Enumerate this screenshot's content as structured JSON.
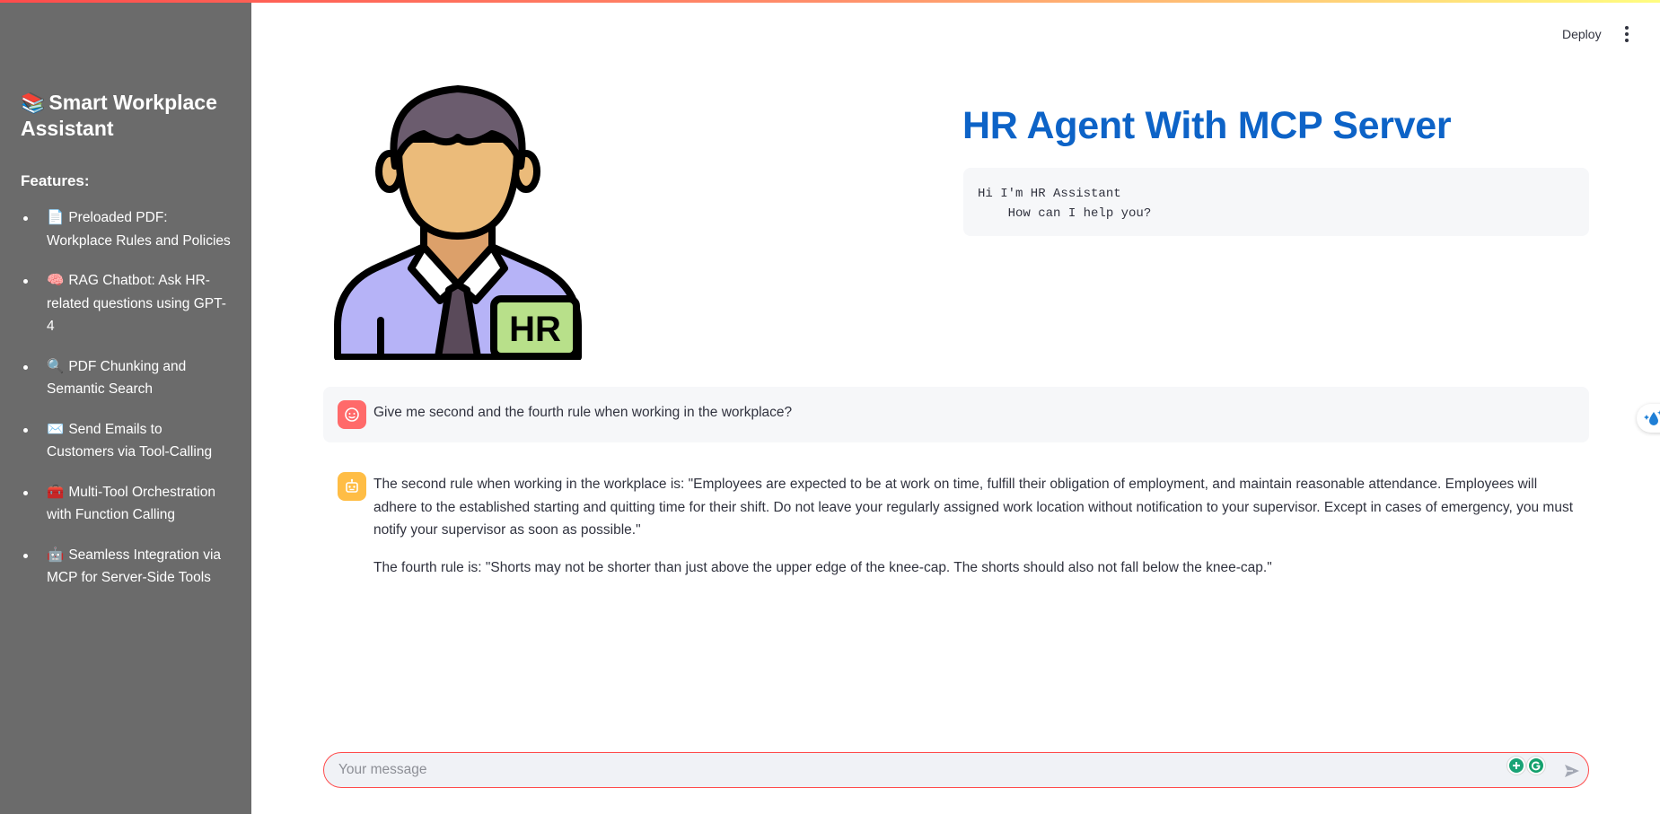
{
  "sidebar": {
    "title_emoji": "📚",
    "title": "Smart Workplace Assistant",
    "features_heading": "Features:",
    "features": [
      {
        "emoji": "📄",
        "label": "Preloaded PDF: Workplace Rules and Policies"
      },
      {
        "emoji": "🧠",
        "label": "RAG Chatbot: Ask HR-related questions using GPT-4"
      },
      {
        "emoji": "🔍",
        "label": "PDF Chunking and Semantic Search"
      },
      {
        "emoji": "✉️",
        "label": "Send Emails to Customers via Tool-Calling"
      },
      {
        "emoji": "🧰",
        "label": "Multi-Tool Orchestration with Function Calling"
      },
      {
        "emoji": "🤖",
        "label": "Seamless Integration via MCP for Server-Side Tools"
      }
    ]
  },
  "header": {
    "deploy_label": "Deploy"
  },
  "avatar": {
    "badge_text": "HR"
  },
  "main": {
    "title": "HR Agent With MCP Server",
    "greeting": "Hi I'm HR Assistant\n    How can I help you?"
  },
  "chat": {
    "user_message": "Give me second and the fourth rule when working in the workplace?",
    "assistant_paragraphs": [
      "The second rule when working in the workplace is: \"Employees are expected to be at work on time, fulfill their obligation of employment, and maintain reasonable attendance. Employees will adhere to the established starting and quitting time for their shift. Do not leave your regularly assigned work location without notification to your supervisor. Except in cases of emergency, you must notify your supervisor as soon as possible.\"",
      "The fourth rule is: \"Shorts may not be shorter than just above the upper edge of the knee-cap. The shorts should also not fall below the knee-cap.\""
    ],
    "input_placeholder": "Your message"
  },
  "colors": {
    "sidebar_bg": "#6b6b6b",
    "title_blue": "#0d63c7",
    "user_avatar": "#ff6a6a",
    "assistant_avatar": "#ffbd45",
    "input_border": "#ff4b4b"
  },
  "icons": {
    "menu": "kebab-menu-icon",
    "user": "user-face-icon",
    "assistant": "robot-icon",
    "send": "send-arrow-icon"
  }
}
